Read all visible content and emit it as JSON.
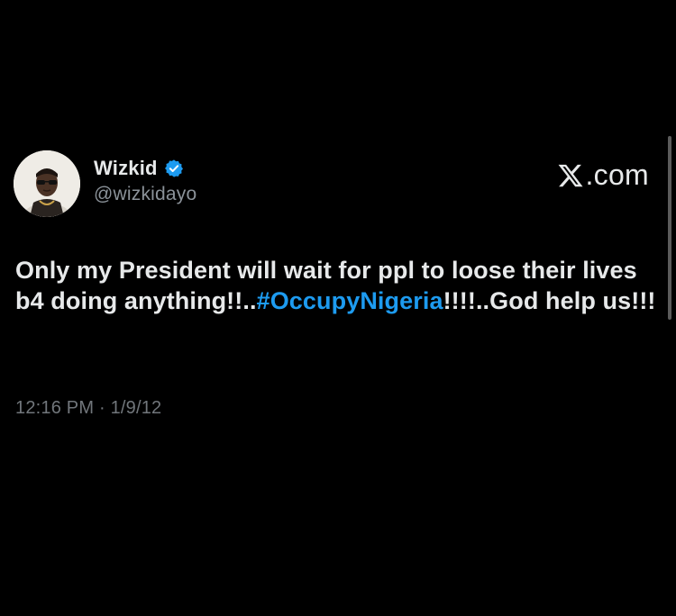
{
  "tweet": {
    "author": {
      "display_name": "Wizkid",
      "handle": "@wizkidayo",
      "verified": true,
      "avatar_icon": "profile-photo"
    },
    "brand": {
      "logo_icon": "x-logo-icon",
      "domain_suffix": ".com"
    },
    "text": {
      "before_hashtag": "Only my President will wait for ppl to loose their lives b4 doing anything!!..",
      "hashtag": "#OccupyNigeria",
      "after_hashtag": "!!!!..God help us!!!"
    },
    "timestamp": "12:16 PM · 1/9/12"
  },
  "colors": {
    "background": "#000000",
    "text_primary": "#e7e9ea",
    "text_secondary": "#71767b",
    "hashtag": "#1d9bf0",
    "verified_badge": "#1d9bf0"
  }
}
